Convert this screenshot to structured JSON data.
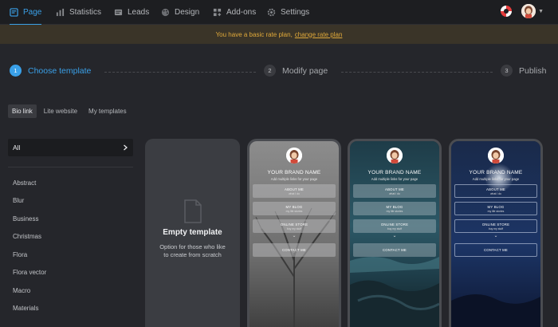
{
  "nav": {
    "items": [
      {
        "label": "Page",
        "icon": "page-icon"
      },
      {
        "label": "Statistics",
        "icon": "chart-icon"
      },
      {
        "label": "Leads",
        "icon": "leads-icon"
      },
      {
        "label": "Design",
        "icon": "palette-icon"
      },
      {
        "label": "Add-ons",
        "icon": "addons-icon"
      },
      {
        "label": "Settings",
        "icon": "gear-icon"
      }
    ]
  },
  "banner": {
    "text": "You have a basic rate plan,",
    "link": "change rate plan"
  },
  "steps": [
    {
      "num": "1",
      "label": "Choose template"
    },
    {
      "num": "2",
      "label": "Modify page"
    },
    {
      "num": "3",
      "label": "Publish"
    }
  ],
  "tabs": [
    "Bio link",
    "Lite website",
    "My templates"
  ],
  "sidebar": {
    "all_label": "All",
    "categories": [
      "Abstract",
      "Blur",
      "Business",
      "Christmas",
      "Flora",
      "Flora vector",
      "Macro",
      "Materials"
    ]
  },
  "empty_template": {
    "title": "Empty template",
    "desc": "Option for those who like to create from scratch"
  },
  "template": {
    "brand": "YOUR BRAND NAME",
    "subtitle": "Add multiple links for your page",
    "buttons": [
      {
        "title": "ABOUT ME",
        "sub": "what I do"
      },
      {
        "title": "MY BLOG",
        "sub": "my life stories"
      },
      {
        "title": "ONLINE STORE",
        "sub": "buy my stuff"
      }
    ],
    "contact": "CONTACT ME"
  },
  "colors": {
    "accent": "#3aa0e8",
    "banner_text": "#e0a93a",
    "background": "#25262b"
  }
}
